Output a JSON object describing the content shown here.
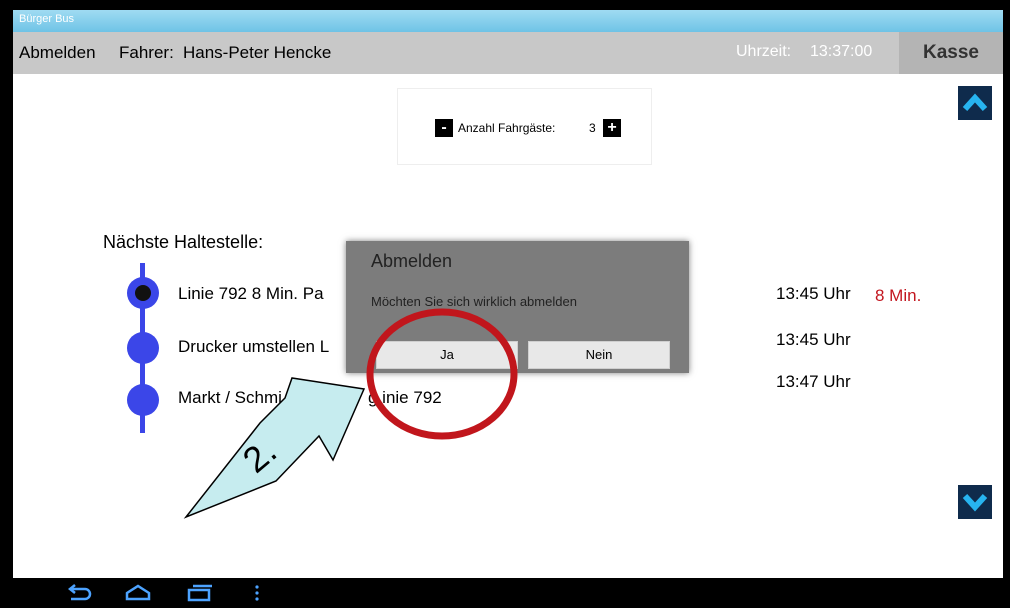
{
  "app": {
    "window_title": "Bürger Bus"
  },
  "header": {
    "logout_label": "Abmelden",
    "driver_label": "Fahrer:",
    "driver_name": "Hans-Peter Hencke",
    "clock_label": "Uhrzeit:",
    "clock_time": "13:37:00",
    "cash_label": "Kasse"
  },
  "passengers": {
    "label": "Anzahl Fahrgäste:",
    "count": "3",
    "minus_symbol": "-",
    "plus_symbol": "+"
  },
  "stops": {
    "heading": "Nächste Haltestelle:",
    "items": [
      {
        "text": "Linie 792  8 Min. Pa",
        "time": "13:45 Uhr",
        "delay": "8 Min.",
        "current": true
      },
      {
        "text": "Drucker umstellen L",
        "time": "13:45 Uhr",
        "delay": "",
        "current": false
      },
      {
        "text": "Markt / Schmi",
        "time": "13:47 Uhr",
        "delay": "",
        "current": false
      }
    ],
    "third_stop_tail": "g  inie 792"
  },
  "dialog": {
    "title": "Abmelden",
    "message": "Möchten Sie sich wirklich abmelden",
    "confirm_label": "Ja",
    "cancel_label": "Nein"
  },
  "annotation": {
    "step_label": "2.",
    "arrow_color": "#c6ecef",
    "circle_color": "#c1161c"
  },
  "navbar": {
    "icons": [
      "back-icon",
      "home-icon",
      "recents-icon",
      "menu-icon"
    ]
  },
  "colors": {
    "accent_blue": "#3b46e8",
    "delay_red": "#c2161f",
    "header_gray": "#c8c8c8",
    "dialog_gray": "#7c7c7c"
  }
}
